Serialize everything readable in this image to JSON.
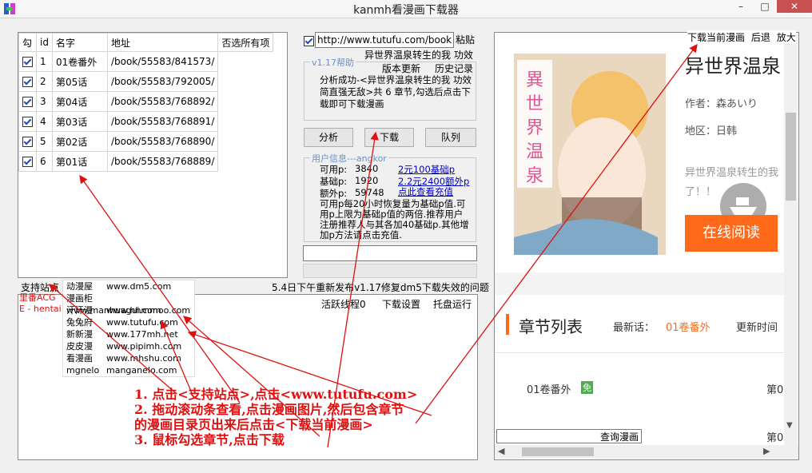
{
  "window": {
    "title": "kanmh看漫画下载器",
    "min": "–",
    "max": "□",
    "close": "✕"
  },
  "table": {
    "headers": [
      "勾",
      "id",
      "名字",
      "地址",
      "否选所有项"
    ],
    "rows": [
      {
        "checked": true,
        "id": "1",
        "name": "01卷番外",
        "addr": "/book/55583/841573/"
      },
      {
        "checked": true,
        "id": "2",
        "name": "第05话",
        "addr": "/book/55583/792005/"
      },
      {
        "checked": true,
        "id": "3",
        "name": "第04话",
        "addr": "/book/55583/768892/"
      },
      {
        "checked": true,
        "id": "4",
        "name": "第03话",
        "addr": "/book/55583/768891/"
      },
      {
        "checked": true,
        "id": "5",
        "name": "第02话",
        "addr": "/book/55583/768890/"
      },
      {
        "checked": true,
        "id": "6",
        "name": "第01话",
        "addr": "/book/55583/768889/"
      }
    ]
  },
  "url": {
    "value": "http://www.tutufu.com/book/",
    "paste": "粘贴"
  },
  "info_title": "异世界温泉转生的我 功效",
  "help": {
    "label": "v1.17帮助",
    "update": "版本更新",
    "history": "历史记录",
    "message": "分析成功-<异世界温泉转生的我 功效简直强无敌>共 6 章节,勾选后点击下载即可下载漫画"
  },
  "actions": {
    "analyze": "分析",
    "download": "下载",
    "queue": "队列"
  },
  "user": {
    "label": "用户信息---angkor",
    "available_label": "可用p:",
    "available": "3840",
    "base_label": "基础p:",
    "base": "1920",
    "extra_label": "额外p:",
    "extra": "59748",
    "link1": "2元100基础p",
    "link2": "2.2元2400额外p",
    "link3": "点此查看充值",
    "desc": "可用p每20小时恢复量为基础p值.可用p上限为基础p值的两倍.推荐用户注册推荐人与其各加40基础p.其他增加p方法请点击充值."
  },
  "sites_label": "支持站点",
  "sites": [
    {
      "name": "动漫屋",
      "url": "www.dm5.com"
    },
    {
      "name": "漫画柜",
      "url": "www.manhuagui.com"
    },
    {
      "name": "汗汗漫",
      "url": "www.hhmmoo.com"
    },
    {
      "name": "兔兔府",
      "url": "www.tutufu.com"
    },
    {
      "name": "新新漫",
      "url": "www.177mh.net"
    },
    {
      "name": "皮皮漫",
      "url": "www.pipimh.com"
    },
    {
      "name": "看漫画",
      "url": "www.mhshu.com"
    },
    {
      "name": "mgnelo",
      "url": "manganelo.com"
    }
  ],
  "side_labels": [
    "里番ACG",
    "E - hentai"
  ],
  "release": "5.4日下午重新发布v1.17修复dm5下载失效的问题",
  "status": {
    "threads": "活跃线程0",
    "settings": "下载设置",
    "tray": "托盘运行"
  },
  "instructions": [
    "1. 点击<支持站点>,点击<www.tutufu.com>",
    "2. 拖动滚动条查看,点击漫画图片,然后包含章节",
    "的漫画目录页出来后点击<下载当前漫画>",
    "3. 鼠标勾选章节,点击下载"
  ],
  "browser": {
    "toolbar": [
      "下载当前漫画",
      "后退",
      "放大"
    ],
    "comic_title": "异世界温泉",
    "author": "作者：森あいり",
    "region": "地区：日韩",
    "desc": "异世界温泉转生的我",
    "desc2": "了！！",
    "read": "在线阅读",
    "chapter_heading": "章节列表",
    "latest_label": "最新话：",
    "latest": "01卷番外",
    "update_label": "更新时间",
    "chapter1": "01卷番外",
    "free": "免",
    "right1": "第0",
    "right2": "第0",
    "query": "查询漫画"
  },
  "colors": {
    "accent": "#ff6a1a",
    "red": "#e01010",
    "link": "#0000cc"
  }
}
